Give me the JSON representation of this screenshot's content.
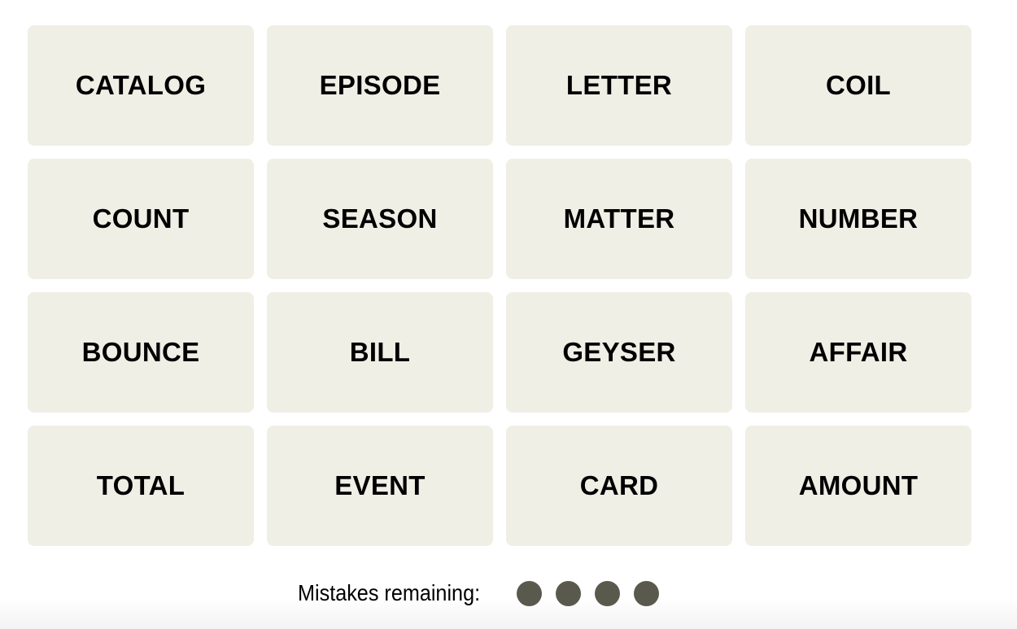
{
  "tiles": [
    "CATALOG",
    "EPISODE",
    "LETTER",
    "COIL",
    "COUNT",
    "SEASON",
    "MATTER",
    "NUMBER",
    "BOUNCE",
    "BILL",
    "GEYSER",
    "AFFAIR",
    "TOTAL",
    "EVENT",
    "CARD",
    "AMOUNT"
  ],
  "mistakes": {
    "label": "Mistakes remaining:",
    "remaining": 4,
    "dot_color": "#5a594e"
  },
  "colors": {
    "tile_bg": "#efefe6"
  }
}
